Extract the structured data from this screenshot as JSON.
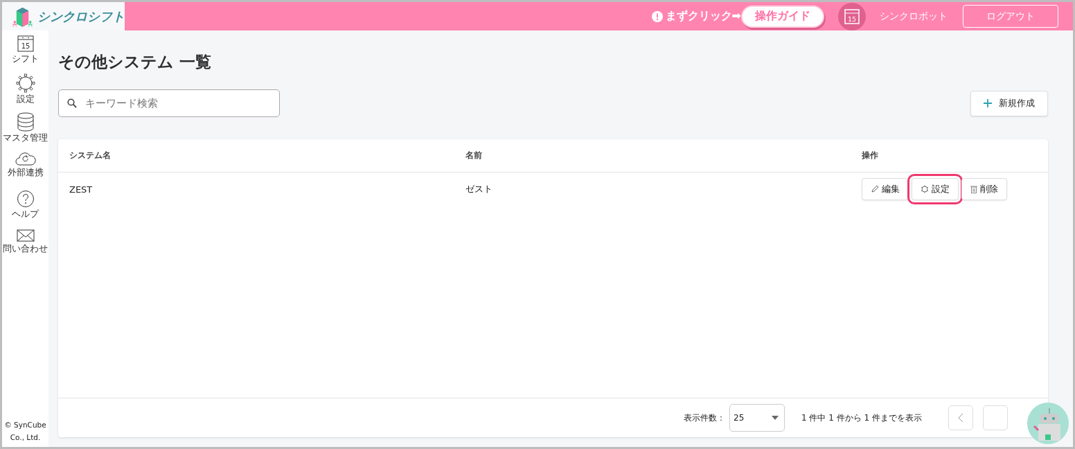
{
  "header": {
    "logo_text": "シンクロシフト",
    "guide_hint": "まずクリック➡",
    "guide_button": "操作ガイド",
    "calendar_day": "15",
    "bot_label": "シンクロボット",
    "logout": "ログアウト"
  },
  "sidebar": {
    "items": [
      {
        "kind": "calendar",
        "icon_text": "15",
        "label": "シフト"
      },
      {
        "kind": "gear",
        "label": "設定"
      },
      {
        "kind": "database",
        "label": "マスタ管理"
      },
      {
        "kind": "cloud",
        "label": "外部連携"
      },
      {
        "kind": "help",
        "label": "ヘルプ"
      },
      {
        "kind": "mail",
        "label": "問い合わせ"
      }
    ],
    "copyright": "© SynCube Co., Ltd."
  },
  "page": {
    "title": "その他システム 一覧",
    "search": {
      "placeholder": "キーワード検索"
    },
    "new_button": "新規作成"
  },
  "table": {
    "columns": [
      "システム名",
      "名前",
      "操作"
    ],
    "rows": [
      {
        "cells": [
          "ZEST",
          "ゼスト"
        ],
        "actions": [
          {
            "kind": "edit",
            "label": "編集",
            "highlighted": false
          },
          {
            "kind": "settings",
            "label": "設定",
            "highlighted": true
          },
          {
            "kind": "delete",
            "label": "削除",
            "highlighted": false
          }
        ]
      }
    ]
  },
  "footer": {
    "page_size_label": "表示件数：",
    "page_size": "25",
    "summary": "1 件中 1 件から 1 件までを表示"
  }
}
